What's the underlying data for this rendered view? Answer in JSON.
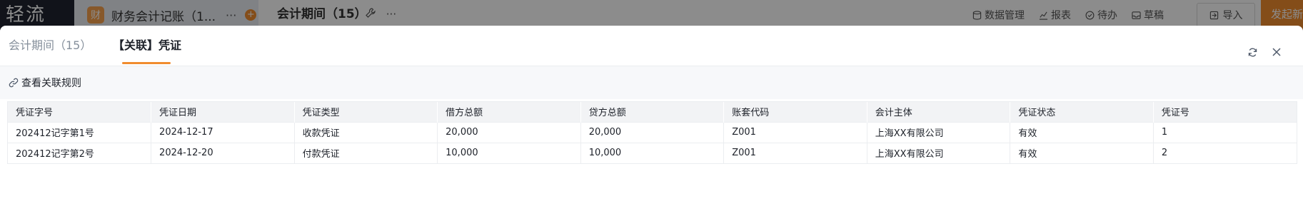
{
  "background": {
    "logo_text": "轻流",
    "app_icon_text": "财",
    "app_tab_title": "财务会计记账（1...",
    "app_tab_more": "···",
    "app_tab_add": "+",
    "page_title": "会计期间（15）",
    "page_tools_more": "···",
    "actions": [
      {
        "icon": "database-icon",
        "label": "数据管理"
      },
      {
        "icon": "chart-icon",
        "label": "报表"
      },
      {
        "icon": "check-circle-icon",
        "label": "待办"
      },
      {
        "icon": "inbox-icon",
        "label": "草稿"
      }
    ],
    "import_label": "导入",
    "primary_label": "发起新"
  },
  "modal": {
    "tabs": [
      {
        "label": "会计期间（15）",
        "active": false
      },
      {
        "label": "【关联】凭证",
        "active": true
      }
    ],
    "accent_color": "#f08c2e",
    "toolbar": {
      "rules_link_label": "查看关联规则",
      "rules_icon": "link-icon"
    },
    "header_buttons": {
      "refresh_icon": "refresh-icon",
      "close_icon": "close-icon"
    }
  },
  "table": {
    "columns": [
      "凭证字号",
      "凭证日期",
      "凭证类型",
      "借方总额",
      "贷方总额",
      "账套代码",
      "会计主体",
      "凭证状态",
      "凭证号"
    ],
    "rows": [
      [
        "202412记字第1号",
        "2024-12-17",
        "收款凭证",
        "20,000",
        "20,000",
        "Z001",
        "上海XX有限公司",
        "有效",
        "1"
      ],
      [
        "202412记字第2号",
        "2024-12-20",
        "付款凭证",
        "10,000",
        "10,000",
        "Z001",
        "上海XX有限公司",
        "有效",
        "2"
      ]
    ]
  }
}
